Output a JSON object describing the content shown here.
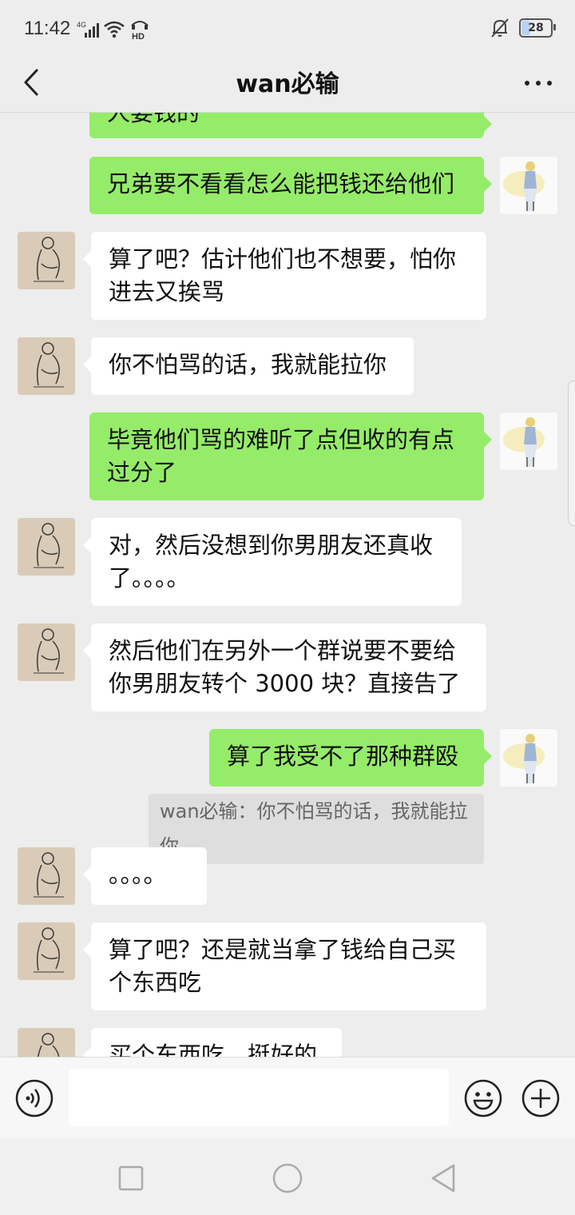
{
  "status_bar": {
    "time": "11:42",
    "network": "4G",
    "hd": "HD",
    "battery": "28",
    "battery_level": 0.28
  },
  "header": {
    "back_label": "back",
    "title": "wan必输",
    "more_label": "more"
  },
  "avatars": {
    "contact": "sketch-figure-avatar",
    "me": "anime-character-avatar"
  },
  "messages": [
    {
      "from": "me",
      "text": "人要钱的"
    },
    {
      "from": "me",
      "text": "兄弟要不看看怎么能把钱还给他们"
    },
    {
      "from": "contact",
      "text": "算了吧？估计他们也不想要，怕你进去又挨骂"
    },
    {
      "from": "contact",
      "text": "你不怕骂的话，我就能拉你"
    },
    {
      "from": "me",
      "text": "毕竟他们骂的难听了点但收的有点过分了"
    },
    {
      "from": "contact",
      "text": "对，然后没想到你男朋友还真收了。。。。"
    },
    {
      "from": "contact",
      "text": "然后他们在另外一个群说要不要给你男朋友转个 3000 块？直接告了"
    },
    {
      "from": "me",
      "text": "算了我受不了那种群殴"
    },
    {
      "from": "contact",
      "text": "。。。。"
    },
    {
      "from": "contact",
      "text": "算了吧？还是就当拿了钱给自己买个东西吃"
    },
    {
      "from": "contact",
      "text": "买个东西吃，挺好的"
    }
  ],
  "quote": {
    "text": "wan必输：你不怕骂的话，我就能拉你"
  },
  "input_bar": {
    "value": "",
    "placeholder": ""
  },
  "colors": {
    "outgoing_bubble": "#95ec69",
    "incoming_bubble": "#ffffff",
    "background": "#ededed"
  }
}
